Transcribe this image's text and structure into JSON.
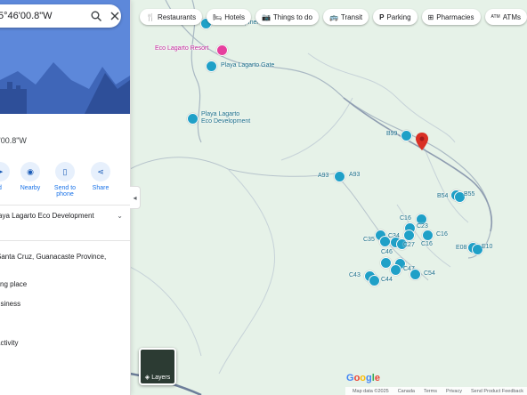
{
  "search": {
    "value": "5°46'00.8\"W"
  },
  "place": {
    "coord": "5'00.8\"W"
  },
  "actions": [
    {
      "label": "d"
    },
    {
      "label": "Nearby"
    },
    {
      "label": "Send to phone"
    },
    {
      "label": "Share"
    }
  ],
  "nearby_select": "aya Lagarto Eco Development",
  "info": {
    "address": "Santa Cruz, Guanacaste Province,",
    "line2": "ting place",
    "line3": "usiness",
    "line4": "activity"
  },
  "chips": [
    {
      "label": "Restaurants",
      "icon": "restaurant-icon"
    },
    {
      "label": "Hotels",
      "icon": "hotel-icon"
    },
    {
      "label": "Things to do",
      "icon": "camera-icon"
    },
    {
      "label": "Transit",
      "icon": "bus-icon"
    },
    {
      "label": "Parking",
      "icon": "parking-icon"
    },
    {
      "label": "Pharmacies",
      "icon": "pharmacy-icon"
    },
    {
      "label": "ATMs",
      "icon": "atm-icon"
    }
  ],
  "map_labels": {
    "eco_top": "Eco Development",
    "eco_resort": "Eco Lagarto Resort",
    "gate": "Playa Lagarto Gate",
    "eco_dev1": "Playa Lagarto",
    "eco_dev2": "Eco Development",
    "B99": "B99",
    "A93a": "A93",
    "A93b": "A93",
    "B54": "B54",
    "B55": "B55",
    "C16a": "C16",
    "C23": "C23",
    "C35": "C35",
    "C34": "C34",
    "C27": "C27",
    "C16b": "C16",
    "C16c": "C16",
    "E08": "E08",
    "E10": "E10",
    "C46": "C46",
    "C43": "C43",
    "C44": "C44",
    "C47": "C47",
    "C54": "C54"
  },
  "layers_label": "Layers",
  "google": "Google",
  "footer": [
    "Map data ©2025",
    "Canada",
    "Terms",
    "Privacy",
    "Send Product Feedback"
  ],
  "colors": {
    "accent": "#1a73e8",
    "pin": "#1fa0c7",
    "red_pin": "#d93025",
    "map_bg": "#e8f3ea"
  }
}
